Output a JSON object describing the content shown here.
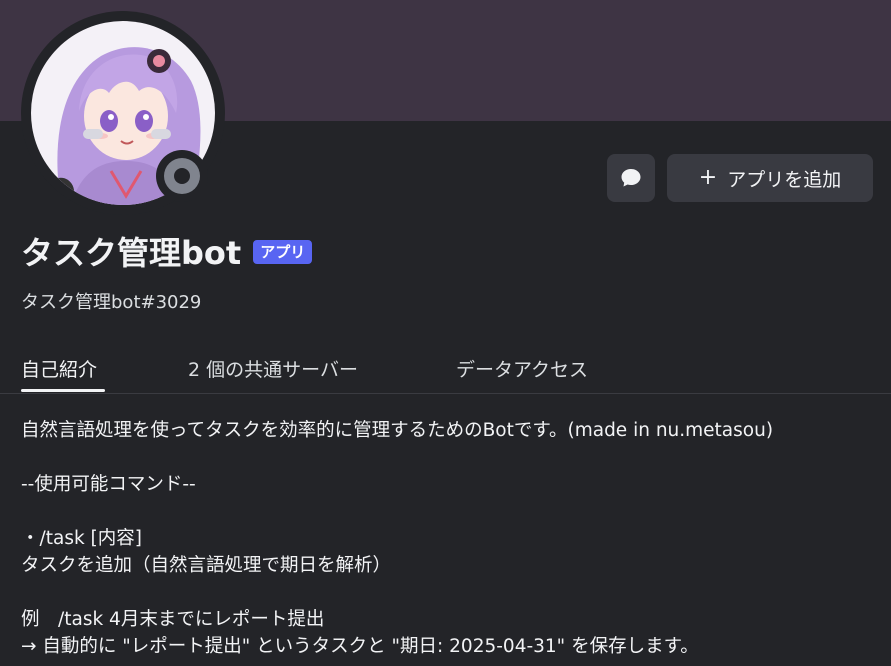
{
  "profile": {
    "display_name": "タスク管理bot",
    "badge": "アプリ",
    "username": "タスク管理bot#3029",
    "status": "offline",
    "avatar_icon": "avatar-image"
  },
  "actions": {
    "message_icon": "chat-bubble-icon",
    "add_app_plus": "+",
    "add_app_label": "アプリを追加"
  },
  "tabs": [
    {
      "label": "自己紹介",
      "active": true
    },
    {
      "label": "2 個の共通サーバー",
      "active": false
    },
    {
      "label": "データアクセス",
      "active": false
    }
  ],
  "bio": {
    "line1": "自然言語処理を使ってタスクを効率的に管理するためのBotです。(made in nu.metasou)",
    "line2": "--使用可能コマンド--",
    "line3": "・/task [内容]",
    "line4": "タスクを追加（自然言語処理で期日を解析）",
    "line5": "例　/task 4月末までにレポート提出",
    "line6": "→ 自動的に \"レポート提出\" というタスクと \"期日: 2025-04-31\" を保存します。"
  },
  "colors": {
    "banner": "#3e3444",
    "background": "#232428",
    "badge": "#5865f2",
    "button": "#393a41",
    "status_offline": "#80848e"
  }
}
